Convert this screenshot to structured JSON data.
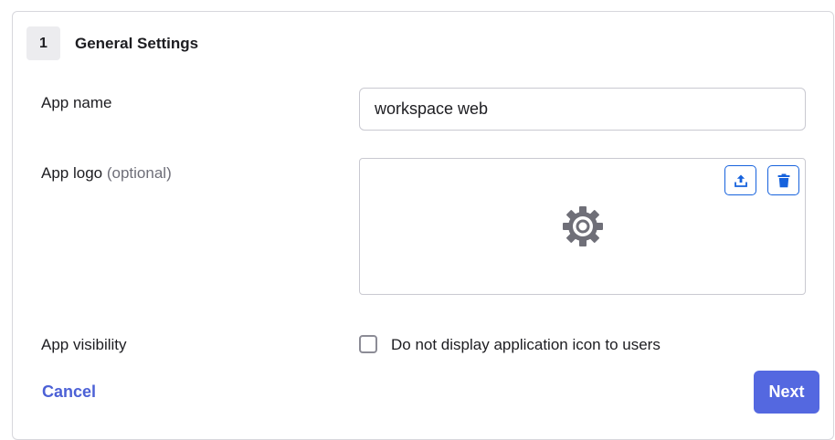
{
  "section": {
    "step_number": "1",
    "title": "General Settings"
  },
  "app_name": {
    "label": "App name",
    "value": "workspace web"
  },
  "app_logo": {
    "label": "App logo",
    "optional": "(optional)",
    "placeholder_icon": "gear-icon",
    "upload_icon": "upload-icon",
    "delete_icon": "trash-icon"
  },
  "app_visibility": {
    "label": "App visibility",
    "checkbox_label": "Do not display application icon to users",
    "checked": false
  },
  "footer": {
    "cancel_label": "Cancel",
    "next_label": "Next"
  },
  "colors": {
    "primary": "#5468e0",
    "link": "#4c61d6",
    "icon_button": "#1662dd"
  }
}
